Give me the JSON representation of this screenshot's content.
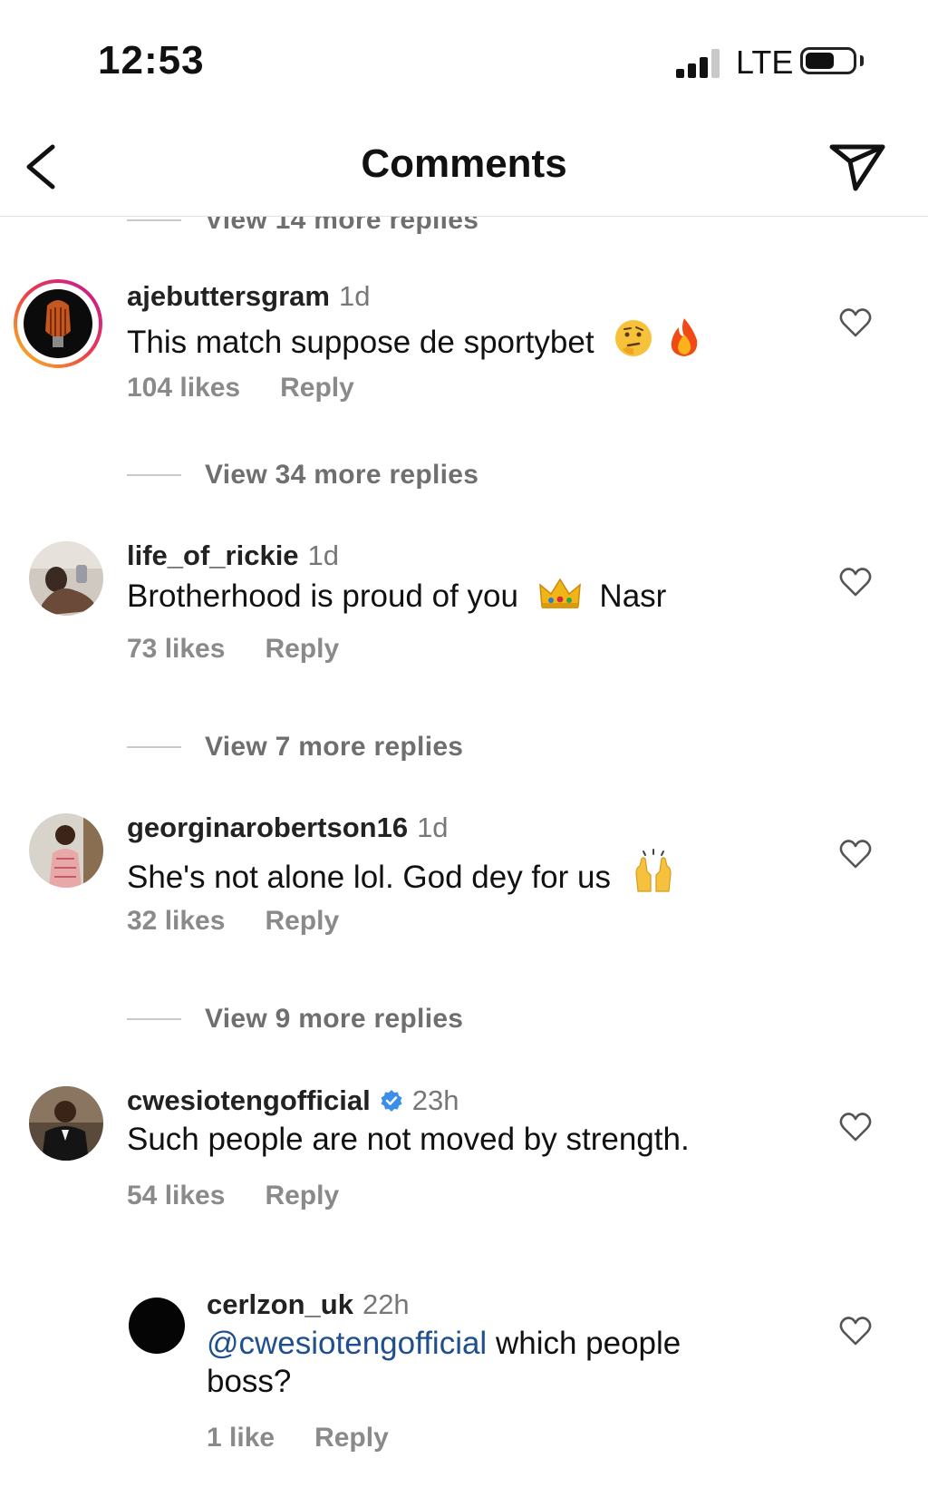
{
  "status_bar": {
    "time": "12:53",
    "network": "LTE",
    "signal_bars_active": 3,
    "battery_level": 0.55
  },
  "header": {
    "title": "Comments",
    "back_icon": "chevron-left-icon",
    "send_icon": "paper-plane-icon"
  },
  "colors": {
    "mention": "#1f4f8f",
    "verified": "#3b8fe8",
    "muted": "#8a8a8a",
    "story_ring_start": "#f8c21a",
    "story_ring_end": "#c2189a"
  },
  "top_view_more": "View 14 more replies",
  "comments": [
    {
      "username": "ajebuttersgram",
      "time": "1d",
      "text": "This match suppose de sportybet",
      "emojis": [
        "thinking-face",
        "fire"
      ],
      "likes": "104 likes",
      "reply": "Reply",
      "view_more": "View 34 more replies"
    },
    {
      "username": "life_of_rickie",
      "time": "1d",
      "text": "Brotherhood is proud of you",
      "emojis": [
        "crown"
      ],
      "text_after": "Nasr",
      "likes": "73 likes",
      "reply": "Reply",
      "view_more": "View 7 more replies"
    },
    {
      "username": "georginarobertson16",
      "time": "1d",
      "text": "She's not alone lol. God dey for us",
      "emojis": [
        "raising-hands"
      ],
      "likes": "32 likes",
      "reply": "Reply",
      "view_more": "View 9 more replies"
    },
    {
      "username": "cwesiotengofficial",
      "verified": true,
      "time": "23h",
      "text": "Such people are not moved by strength.",
      "likes": "54 likes",
      "reply": "Reply"
    }
  ],
  "reply": {
    "username": "cerlzon_uk",
    "time": "22h",
    "mention": "@cwesiotengofficial",
    "text_line1": "which people",
    "text_line2": "boss?",
    "likes": "1 like",
    "reply": "Reply"
  }
}
